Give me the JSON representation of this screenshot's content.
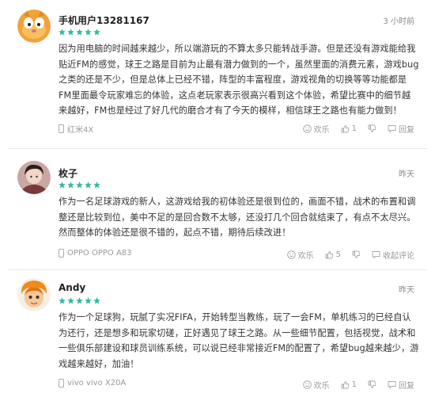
{
  "reviews": [
    {
      "username": "手机用户13281167",
      "time": "3 小时前",
      "rating": 5,
      "content_lines": [
        "因为用电脑的时间越来越少，所以端游玩的不算太多只能转战手游。但是还没有游戏能给我",
        "贴近FM的感觉，球王之路是目前为止最有潜力做到的一个，虽然里面的消费元素，游戏bug",
        "之类的还是不少，但是总体上已经不错，阵型的丰富程度，游戏视角的切换等等功能都是",
        "FM里面最令玩家难忘的体验，这点老玩家表示很高兴看到这个体验，希望比赛中的细节越",
        "来越好，FM也是经过了好几代的磨合才有了今天的模样，相信球王之路也有能力做到！"
      ],
      "device": "红米4X",
      "actions": {
        "dislike": "欢乐",
        "like": "1",
        "reply": "回复"
      }
    },
    {
      "username": "枚子",
      "time": "昨天",
      "rating": 5,
      "content_lines": [
        "作为一名足球游戏的新人，这游戏给我的初体验还是很到位的，画面不错，战术的布置和调",
        "整还是比较到位，美中不足的是回合数不太够，还没打几个回合就结束了，有点不太尽兴。",
        "然而整体的体验还是很不错的，起点不错，期待后续改进！"
      ],
      "device": "OPPO OPPO A83",
      "actions": {
        "dislike": "欢乐",
        "like": "5",
        "reply": "收起评论"
      }
    },
    {
      "username": "Andy",
      "time": "昨天",
      "rating": 5,
      "content_lines": [
        "作为一个足球狗，玩腻了实况FIFA，开始转型当教练，玩了一会FM，单机练习的已经自认",
        "为还行，还是想多和玩家切磋，正好遇见了球王之路。从一些细节配置，包括视觉，战术和",
        "一些俱乐部建设和球员训练系统，可以说已经非常接近FM的配置了，希望bug越来越少，游",
        "戏越来越好，加油！"
      ],
      "device": "vivo vivo X20A",
      "actions": {
        "dislike": "欢乐",
        "like": "1",
        "reply": "回复"
      }
    }
  ],
  "colors": {
    "star": "#35b9a0",
    "text": "#333333",
    "meta": "#999999"
  }
}
